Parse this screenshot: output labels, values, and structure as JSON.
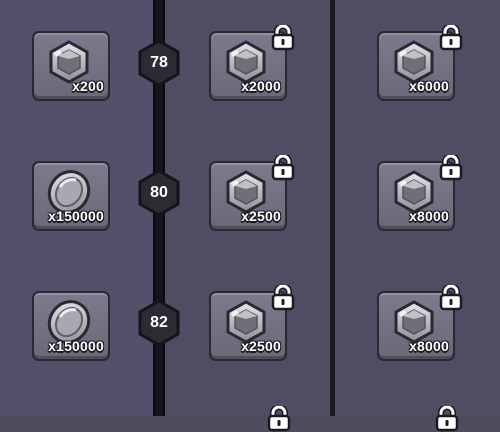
{
  "tiers": [
    {
      "level": "78",
      "free": {
        "item": "gem-icon",
        "qty": "x200"
      },
      "paid": [
        {
          "item": "gem-icon",
          "qty": "x2000",
          "locked": true
        },
        {
          "item": "gem-icon",
          "qty": "x6000",
          "locked": true
        }
      ]
    },
    {
      "level": "80",
      "free": {
        "item": "coin-icon",
        "qty": "x150000"
      },
      "paid": [
        {
          "item": "gem-icon",
          "qty": "x2500",
          "locked": true
        },
        {
          "item": "gem-icon",
          "qty": "x8000",
          "locked": true
        }
      ]
    },
    {
      "level": "82",
      "free": {
        "item": "coin-icon",
        "qty": "x150000"
      },
      "paid": [
        {
          "item": "gem-icon",
          "qty": "x2500",
          "locked": true
        },
        {
          "item": "gem-icon",
          "qty": "x8000",
          "locked": true
        }
      ]
    }
  ],
  "colors": {
    "background": "#4d4b5c",
    "tile": "#757283",
    "track": "#14131a",
    "badge": "#2c2b33"
  }
}
